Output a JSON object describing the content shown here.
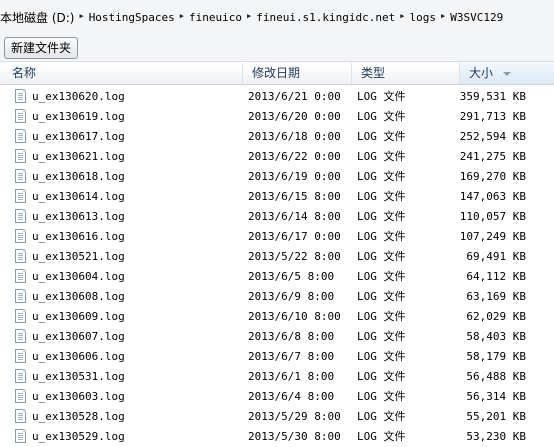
{
  "breadcrumb": {
    "items": [
      "本地磁盘 (D:)",
      "HostingSpaces",
      "fineuico",
      "fineui.s1.kingidc.net",
      "logs",
      "W3SVC129"
    ]
  },
  "toolbar": {
    "new_folder_label": "新建文件夹"
  },
  "columns": {
    "name": "名称",
    "date": "修改日期",
    "type": "类型",
    "size": "大小"
  },
  "files": [
    {
      "name": "u_ex130620.log",
      "date": "2013/6/21 0:00",
      "type": "LOG 文件",
      "size": "359,531 KB"
    },
    {
      "name": "u_ex130619.log",
      "date": "2013/6/20 0:00",
      "type": "LOG 文件",
      "size": "291,713 KB"
    },
    {
      "name": "u_ex130617.log",
      "date": "2013/6/18 0:00",
      "type": "LOG 文件",
      "size": "252,594 KB"
    },
    {
      "name": "u_ex130621.log",
      "date": "2013/6/22 0:00",
      "type": "LOG 文件",
      "size": "241,275 KB"
    },
    {
      "name": "u_ex130618.log",
      "date": "2013/6/19 0:00",
      "type": "LOG 文件",
      "size": "169,270 KB"
    },
    {
      "name": "u_ex130614.log",
      "date": "2013/6/15 8:00",
      "type": "LOG 文件",
      "size": "147,063 KB"
    },
    {
      "name": "u_ex130613.log",
      "date": "2013/6/14 8:00",
      "type": "LOG 文件",
      "size": "110,057 KB"
    },
    {
      "name": "u_ex130616.log",
      "date": "2013/6/17 0:00",
      "type": "LOG 文件",
      "size": "107,249 KB"
    },
    {
      "name": "u_ex130521.log",
      "date": "2013/5/22 8:00",
      "type": "LOG 文件",
      "size": "69,491 KB"
    },
    {
      "name": "u_ex130604.log",
      "date": "2013/6/5 8:00",
      "type": "LOG 文件",
      "size": "64,112 KB"
    },
    {
      "name": "u_ex130608.log",
      "date": "2013/6/9 8:00",
      "type": "LOG 文件",
      "size": "63,169 KB"
    },
    {
      "name": "u_ex130609.log",
      "date": "2013/6/10 8:00",
      "type": "LOG 文件",
      "size": "62,029 KB"
    },
    {
      "name": "u_ex130607.log",
      "date": "2013/6/8 8:00",
      "type": "LOG 文件",
      "size": "58,403 KB"
    },
    {
      "name": "u_ex130606.log",
      "date": "2013/6/7 8:00",
      "type": "LOG 文件",
      "size": "58,179 KB"
    },
    {
      "name": "u_ex130531.log",
      "date": "2013/6/1 8:00",
      "type": "LOG 文件",
      "size": "56,488 KB"
    },
    {
      "name": "u_ex130603.log",
      "date": "2013/6/4 8:00",
      "type": "LOG 文件",
      "size": "56,314 KB"
    },
    {
      "name": "u_ex130528.log",
      "date": "2013/5/29 8:00",
      "type": "LOG 文件",
      "size": "55,201 KB"
    },
    {
      "name": "u_ex130529.log",
      "date": "2013/5/30 8:00",
      "type": "LOG 文件",
      "size": "53,230 KB"
    }
  ]
}
